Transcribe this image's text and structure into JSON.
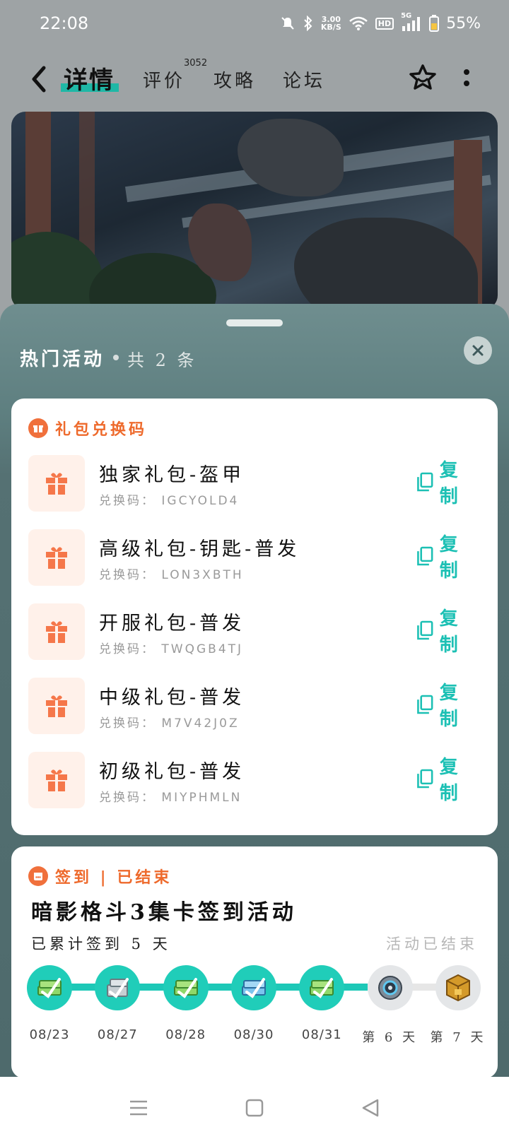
{
  "status_bar": {
    "time": "22:08",
    "speed_value": "3.00",
    "speed_unit": "KB/S",
    "hd": "HD",
    "network": "5G",
    "battery": "55%"
  },
  "nav": {
    "active_tab": "详情",
    "tabs": [
      {
        "label": "评价"
      },
      {
        "label": "攻略"
      },
      {
        "label": "论坛"
      }
    ],
    "review_count": "3052"
  },
  "sheet": {
    "title": "热门活动",
    "count": "共 2 条"
  },
  "gift_section": {
    "label": "礼包兑换码",
    "copy_label": "复制",
    "items": [
      {
        "name": "独家礼包-盔甲",
        "code": "兑换码： IGCYOLD4"
      },
      {
        "name": "高级礼包-钥匙-普发",
        "code": "兑换码： LON3XBTH"
      },
      {
        "name": "开服礼包-普发",
        "code": "兑换码： TWQGB4TJ"
      },
      {
        "name": "中级礼包-普发",
        "code": "兑换码： M7V42J0Z"
      },
      {
        "name": "初级礼包-普发",
        "code": "兑换码： MIYPHMLN"
      }
    ]
  },
  "sign_section": {
    "label": "签到 | 已结束",
    "title": "暗影格斗3集卡签到活动",
    "progress": "已累计签到 5 天",
    "status": "活动已结束",
    "days": [
      {
        "label": "08/23",
        "done": true,
        "icon": "cash-stack-icon"
      },
      {
        "label": "08/27",
        "done": true,
        "icon": "silver-stack-icon"
      },
      {
        "label": "08/28",
        "done": true,
        "icon": "cash-stack-icon"
      },
      {
        "label": "08/30",
        "done": true,
        "icon": "blue-stack-icon"
      },
      {
        "label": "08/31",
        "done": true,
        "icon": "cash-stack-icon"
      },
      {
        "label": "第 6 天",
        "done": false,
        "icon": "disc-icon"
      },
      {
        "label": "第 7 天",
        "done": false,
        "icon": "golden-cube-icon"
      }
    ],
    "completed_days": 5,
    "total_days": 7
  },
  "colors": {
    "accent_teal": "#1dc8b7",
    "accent_orange": "#ee6a2c",
    "sheet_bg": "#557173"
  }
}
